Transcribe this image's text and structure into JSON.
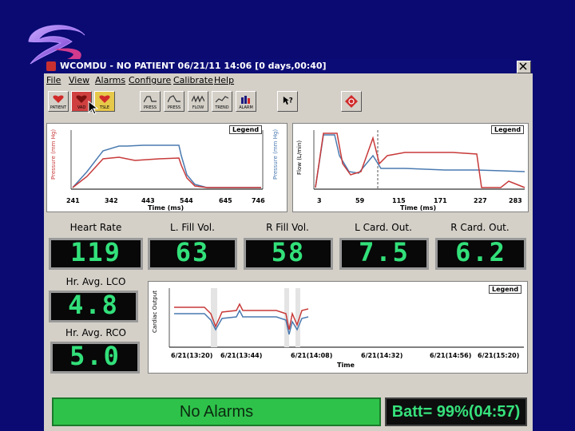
{
  "window": {
    "title": "WCOMDU - NO PATIENT 06/21/11 14:06 [0 days,00:40]"
  },
  "menu": [
    "File",
    "View",
    "Alarms",
    "Configure",
    "Calibrate",
    "Help"
  ],
  "toolbar": {
    "buttons": [
      {
        "label": "PATIENT",
        "icon": "heart-patient-icon"
      },
      {
        "label": "VAD",
        "icon": "red-vad-icon"
      },
      {
        "label": "TSLE",
        "icon": "heart-yellow-icon"
      },
      {
        "label": "PRESS",
        "icon": "pressure-wave-icon"
      },
      {
        "label": "PRESS",
        "icon": "pressure-wave-icon"
      },
      {
        "label": "FLOW",
        "icon": "flow-wave-icon"
      },
      {
        "label": "TREND",
        "icon": "trend-icon"
      },
      {
        "label": "ALARM",
        "icon": "alarm-bars-icon"
      },
      {
        "label": "",
        "icon": "help-pointer-icon"
      },
      {
        "label": "",
        "icon": "red-diamond-icon"
      }
    ]
  },
  "charts": {
    "pressure": {
      "legend": "Legend",
      "xlabel": "Time (ms)",
      "ylabel_left": "Pressure (mm Hg)",
      "ylabel_right": "Pressure (mm Hg)",
      "xticks": [
        "241",
        "342",
        "443",
        "544",
        "645",
        "746"
      ]
    },
    "flow": {
      "legend": "Legend",
      "xlabel": "Time (ms)",
      "ylabel": "Flow (L/min)",
      "xticks": [
        "3",
        "59",
        "115",
        "171",
        "227",
        "283"
      ]
    },
    "trend": {
      "legend": "Legend",
      "xlabel": "Time",
      "ylabel": "Cardiac Output",
      "xticks": [
        "6/21(13:20)",
        "6/21(13:44)",
        "6/21(14:08)",
        "6/21(14:32)",
        "6/21(14:56)",
        "6/21(15:20)"
      ]
    }
  },
  "vitals": {
    "heart_rate": {
      "label": "Heart Rate",
      "value": "119"
    },
    "l_fill": {
      "label": "L. Fill Vol.",
      "value": "63"
    },
    "r_fill": {
      "label": "R Fill Vol.",
      "value": "58"
    },
    "l_card": {
      "label": "L Card. Out.",
      "value": "7.5"
    },
    "r_card": {
      "label": "R Card. Out.",
      "value": "6.2"
    },
    "hr_lco": {
      "label": "Hr. Avg. LCO",
      "value": "4.8"
    },
    "hr_rco": {
      "label": "Hr. Avg. RCO",
      "value": "5.0"
    }
  },
  "status": {
    "alarms": "No Alarms",
    "battery": "Batt= 99%(04:57)"
  },
  "colors": {
    "background": "#0a0a72",
    "window": "#d4d0c8",
    "lcd_digits": "#32e07a",
    "status_ok": "#2ec24a",
    "left_series": "#c83a3a",
    "right_series": "#4a7ab0"
  }
}
